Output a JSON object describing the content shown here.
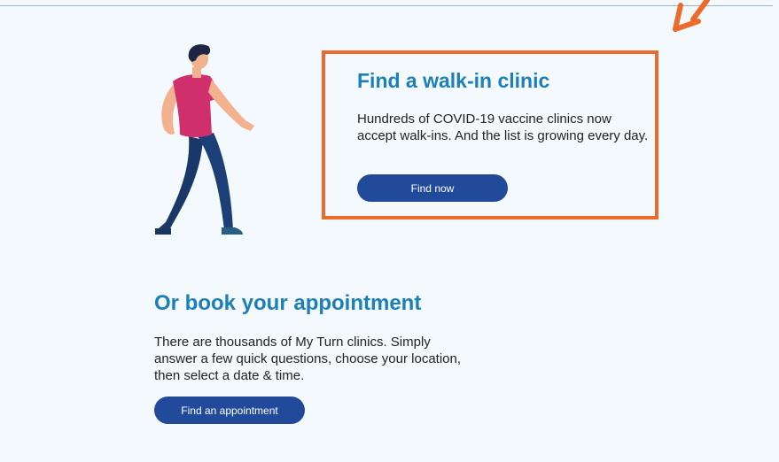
{
  "colors": {
    "page_background": "#f4f9fd",
    "heading": "#1b7fb8",
    "button": "#214a9b",
    "highlight_border": "#ec6a2b"
  },
  "illustration": {
    "icon": "walking-person-illustration"
  },
  "walk_in": {
    "title": "Find a walk-in clinic",
    "description": "Hundreds of COVID-19 vaccine clinics now accept walk-ins. And the list is growing every day.",
    "button_label": "Find now"
  },
  "appointment": {
    "title": "Or book your appointment",
    "description": "There are thousands of My Turn clinics. Simply answer a few quick questions, choose your location, then select a date & time.",
    "button_label": "Find an appointment"
  }
}
